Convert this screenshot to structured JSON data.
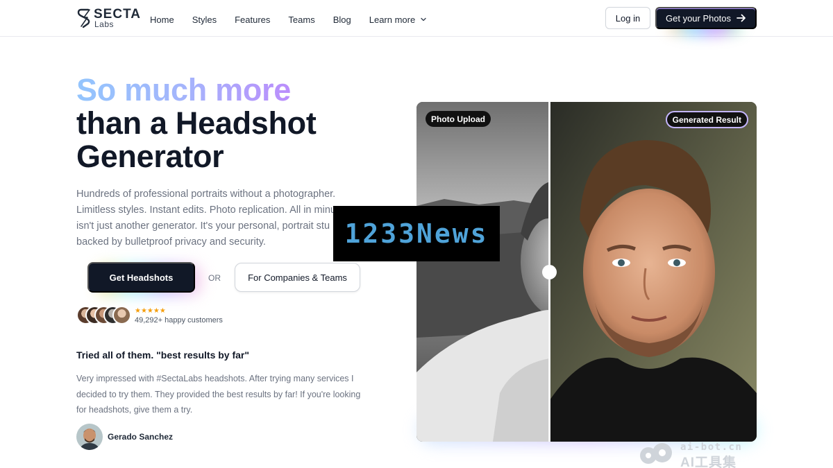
{
  "brand": {
    "name": "SECTA",
    "sub": "Labs"
  },
  "nav": {
    "items": [
      {
        "label": "Home"
      },
      {
        "label": "Styles"
      },
      {
        "label": "Features"
      },
      {
        "label": "Teams"
      },
      {
        "label": "Blog"
      },
      {
        "label": "Learn more",
        "dropdown": true
      }
    ],
    "login_label": "Log in",
    "cta_label": "Get your Photos"
  },
  "hero": {
    "title_gradient": "So much more",
    "title_line2": "than a Headshot",
    "title_line3": "Generator",
    "description": "Hundreds of professional portraits without a photographer. Limitless styles. Instant edits. Photo replication. All in minu isn't just another generator. It's your personal, portrait stu backed by bulletproof privacy and security.",
    "primary_button": "Get Headshots",
    "or_label": "OR",
    "secondary_button": "For Companies & Teams",
    "rating_stars": "★★★★★",
    "customers_text": "49,292+ happy customers"
  },
  "testimonial": {
    "title": "Tried all of them. \"best results by far\"",
    "body": "Very impressed with #SectaLabs headshots. After trying many services I decided to try them. They provided the best results by far! If you're looking for headshots, give them a try.",
    "author": "Gerado Sanchez"
  },
  "comparison": {
    "left_label": "Photo Upload",
    "right_label": "Generated Result",
    "split_fraction": 0.39
  },
  "overlays": {
    "news_watermark": "1233News",
    "site_watermark": "ai-bot.cn",
    "site_watermark_label": "AI工具集"
  },
  "colors": {
    "primary_dark": "#111827",
    "gradient_start": "#93c5fd",
    "gradient_end": "#d946ef",
    "star": "#f59e0b"
  },
  "icons": [
    "secta-logo-icon",
    "chevron-down-icon",
    "arrow-right-icon"
  ]
}
